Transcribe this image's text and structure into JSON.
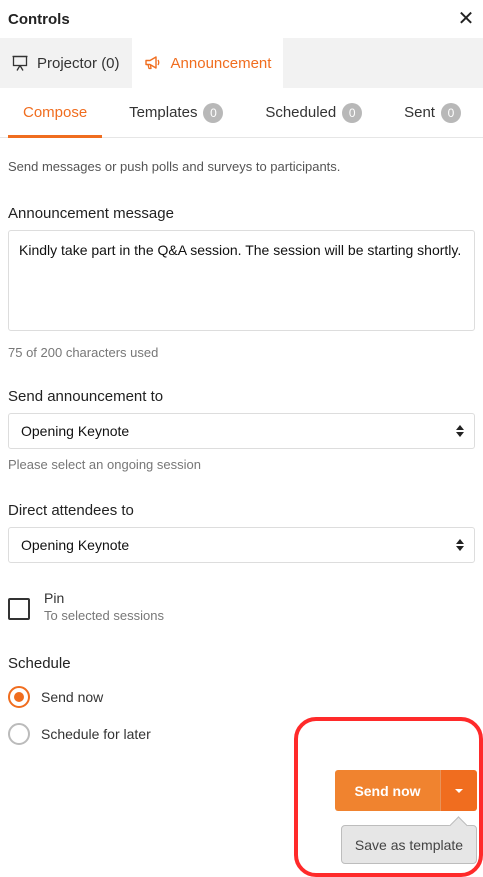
{
  "header": {
    "title": "Controls",
    "close_glyph": "✕"
  },
  "main_tabs": [
    {
      "label": "Projector (0)",
      "icon": "projector-icon"
    },
    {
      "label": "Announcement",
      "icon": "megaphone-icon",
      "active": true
    }
  ],
  "sub_tabs": [
    {
      "label": "Compose",
      "active": true
    },
    {
      "label": "Templates",
      "count": "0"
    },
    {
      "label": "Scheduled",
      "count": "0"
    },
    {
      "label": "Sent",
      "count": "0"
    }
  ],
  "intro_text": "Send messages or push polls and surveys to participants.",
  "message": {
    "label": "Announcement message",
    "value": "Kindly take part in the Q&A session. The session will be starting shortly.",
    "char_count": "75 of 200 characters used"
  },
  "send_to": {
    "label": "Send announcement to",
    "selected": "Opening Keynote",
    "hint": "Please select an ongoing session"
  },
  "direct_to": {
    "label": "Direct attendees to",
    "selected": "Opening Keynote"
  },
  "pin": {
    "label": "Pin",
    "sublabel": "To selected sessions"
  },
  "schedule": {
    "label": "Schedule",
    "options": [
      {
        "label": "Send now",
        "checked": true
      },
      {
        "label": "Schedule for later",
        "checked": false
      }
    ]
  },
  "actions": {
    "send_label": "Send now",
    "save_template_label": "Save as template"
  },
  "colors": {
    "accent": "#f06d1f",
    "send_button": "#f0832f",
    "highlight": "#ff2a2a"
  }
}
